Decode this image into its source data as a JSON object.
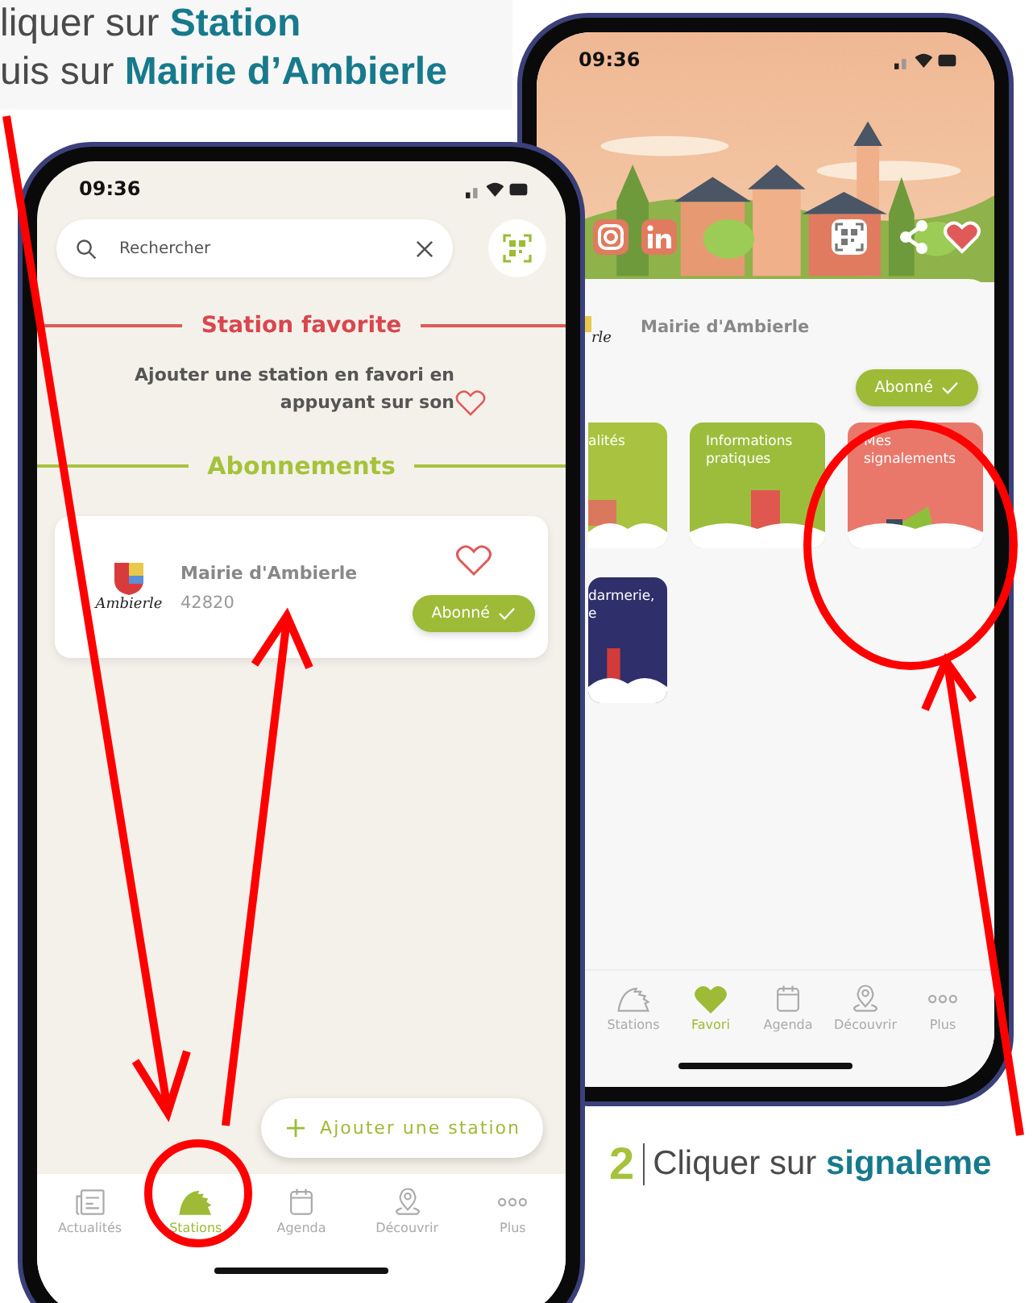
{
  "top_caption": {
    "lines": [
      "liquer sur **Station**",
      "uis sur **Mairie d’Ambierle**"
    ]
  },
  "back_phone": {
    "time": "09:36",
    "favorite": true,
    "station": {
      "logo_text": "rle",
      "name": "Mairie d'Ambierle",
      "button": "Abonné"
    },
    "tiles": [
      {
        "label": "alités",
        "color": "#a9c23f"
      },
      {
        "label": "Informations pratiques",
        "color": "#9cbd3c"
      },
      {
        "label": "Mes signalements",
        "color": "#e9786b"
      },
      {
        "label": "darmerie,\ne",
        "color": "#2e2f6b"
      }
    ],
    "tabs": [
      {
        "label": "Stations",
        "selected": false
      },
      {
        "label": "Favori",
        "selected": true
      },
      {
        "label": "Agenda",
        "selected": false
      },
      {
        "label": "Découvrir",
        "selected": false
      },
      {
        "label": "Plus",
        "selected": false
      }
    ]
  },
  "front_phone": {
    "time": "09:36",
    "search": {
      "placeholder": "Rechercher"
    },
    "favorite_section": {
      "title": "Station favorite",
      "hint": "Ajouter une station en favori en appuyant sur son"
    },
    "subscriptions": {
      "title": "Abonnements",
      "items": [
        {
          "logo_text": "Ambierle",
          "name": "Mairie d'Ambierle",
          "postcode": "42820",
          "favorite": false,
          "button": "Abonné"
        }
      ]
    },
    "add_button": "Ajouter une station",
    "tabs": [
      {
        "label": "Actualités",
        "selected": false
      },
      {
        "label": "Stations",
        "selected": true
      },
      {
        "label": "Agenda",
        "selected": false
      },
      {
        "label": "Découvrir",
        "selected": false
      },
      {
        "label": "Plus",
        "selected": false
      }
    ]
  },
  "bottom_caption": {
    "number": "2",
    "text": "Cliquer sur **signaleme**"
  }
}
